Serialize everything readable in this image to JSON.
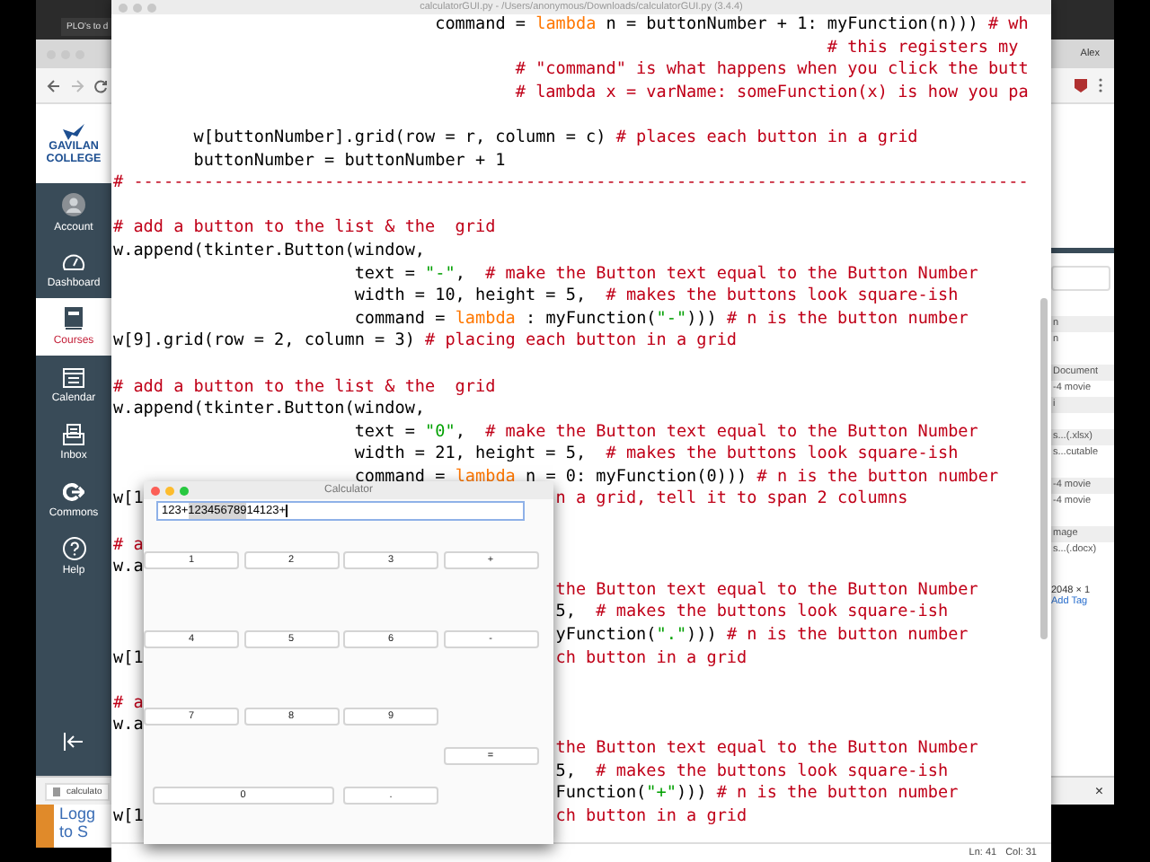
{
  "back_window": {
    "tab_title": "PLO's to d"
  },
  "browser": {
    "profile": "Alex",
    "sidebar": {
      "logo": [
        "GAVILAN",
        "COLLEGE"
      ],
      "items": [
        {
          "kind": "account",
          "label": "Account",
          "selected": false
        },
        {
          "kind": "dashboard",
          "label": "Dashboard",
          "selected": false
        },
        {
          "kind": "courses",
          "label": "Courses",
          "selected": true
        },
        {
          "kind": "calendar",
          "label": "Calendar",
          "selected": false
        },
        {
          "kind": "inbox",
          "label": "Inbox",
          "selected": false
        },
        {
          "kind": "commons",
          "label": "Commons",
          "selected": false
        },
        {
          "kind": "help",
          "label": "Help",
          "selected": false
        }
      ]
    },
    "right_panel": {
      "file_groups": [
        [
          "n",
          "n"
        ],
        [
          "Document",
          "-4 movie",
          "i"
        ],
        [
          "s...(.xlsx)",
          "s...cutable"
        ],
        [
          "-4 movie",
          "-4 movie"
        ],
        [
          "mage",
          "s...(.docx)"
        ]
      ],
      "dimensions": "2048 × 1",
      "add_tag": "Add Tag"
    },
    "download_bar": {
      "file": "calculato",
      "close": "×"
    }
  },
  "background_page": {
    "lines": [
      "Logg",
      "to S"
    ]
  },
  "editor": {
    "title": "calculatorGUI.py - /Users/anonymous/Downloads/calculatorGUI.py (3.4.4)",
    "lines": [
      {
        "kind": "full",
        "segments": [
          {
            "kind": "code",
            "text": "                                command = "
          },
          {
            "kind": "keyword",
            "text": "lambda"
          },
          {
            "kind": "code",
            "text": " n = buttonNumber + 1: myFunction(n))) "
          },
          {
            "kind": "comment",
            "text": "# wh"
          }
        ]
      },
      {
        "kind": "full",
        "segments": [
          {
            "kind": "comment",
            "text": "                                                                       # this registers my"
          }
        ]
      },
      {
        "kind": "full",
        "segments": [
          {
            "kind": "comment",
            "text": "                                        # \"command\" is what happens when you click the butt"
          }
        ]
      },
      {
        "kind": "full",
        "segments": [
          {
            "kind": "comment",
            "text": "                                        # lambda x = varName: someFunction(x) is how you pa"
          }
        ]
      },
      {
        "kind": "blank"
      },
      {
        "kind": "full",
        "segments": [
          {
            "kind": "code",
            "text": "        w[buttonNumber].grid(row = r, column = c) "
          },
          {
            "kind": "comment",
            "text": "# places each button in a grid"
          }
        ]
      },
      {
        "kind": "full",
        "segments": [
          {
            "kind": "code",
            "text": "        buttonNumber = buttonNumber + 1"
          }
        ]
      },
      {
        "kind": "full",
        "segments": [
          {
            "kind": "comment",
            "text": "# -----------------------------------------------------------------------------------------"
          }
        ]
      },
      {
        "kind": "blank"
      },
      {
        "kind": "full",
        "segments": [
          {
            "kind": "comment",
            "text": "# add a button to the list & the  grid"
          }
        ]
      },
      {
        "kind": "full",
        "segments": [
          {
            "kind": "code",
            "text": "w.append(tkinter.Button(window,"
          }
        ]
      },
      {
        "kind": "full",
        "segments": [
          {
            "kind": "code",
            "text": "                        text = "
          },
          {
            "kind": "string",
            "text": "\"-\""
          },
          {
            "kind": "code",
            "text": ",  "
          },
          {
            "kind": "comment",
            "text": "# make the Button text equal to the Button Number"
          }
        ]
      },
      {
        "kind": "full",
        "segments": [
          {
            "kind": "code",
            "text": "                        width = 10, height = 5,  "
          },
          {
            "kind": "comment",
            "text": "# makes the buttons look square-ish"
          }
        ]
      },
      {
        "kind": "full",
        "segments": [
          {
            "kind": "code",
            "text": "                        command = "
          },
          {
            "kind": "keyword",
            "text": "lambda"
          },
          {
            "kind": "code",
            "text": " : myFunction("
          },
          {
            "kind": "string",
            "text": "\"-\""
          },
          {
            "kind": "code",
            "text": "))) "
          },
          {
            "kind": "comment",
            "text": "# n is the button number"
          }
        ]
      },
      {
        "kind": "full",
        "segments": [
          {
            "kind": "code",
            "text": "w[9].grid(row = 2, column = 3) "
          },
          {
            "kind": "comment",
            "text": "# placing each button in a grid"
          }
        ]
      },
      {
        "kind": "blank"
      },
      {
        "kind": "full",
        "segments": [
          {
            "kind": "comment",
            "text": "# add a button to the list & the  grid"
          }
        ]
      },
      {
        "kind": "full",
        "segments": [
          {
            "kind": "code",
            "text": "w.append(tkinter.Button(window,"
          }
        ]
      },
      {
        "kind": "full",
        "segments": [
          {
            "kind": "code",
            "text": "                        text = "
          },
          {
            "kind": "string",
            "text": "\"0\""
          },
          {
            "kind": "code",
            "text": ",  "
          },
          {
            "kind": "comment",
            "text": "# make the Button text equal to the Button Number"
          }
        ]
      },
      {
        "kind": "full",
        "segments": [
          {
            "kind": "code",
            "text": "                        width = 21, height = 5,  "
          },
          {
            "kind": "comment",
            "text": "# makes the buttons look square-ish"
          }
        ]
      },
      {
        "kind": "full",
        "segments": [
          {
            "kind": "code",
            "text": "                        command = "
          },
          {
            "kind": "keyword",
            "text": "lambda"
          },
          {
            "kind": "code",
            "text": " n = 0: myFunction(0))) "
          },
          {
            "kind": "comment",
            "text": "# n is the button number"
          }
        ]
      },
      {
        "kind": "split",
        "left": [
          {
            "kind": "code",
            "text": "w[1"
          }
        ],
        "right": [
          {
            "kind": "comment",
            "text": "n a grid, tell it to span 2 columns"
          }
        ]
      },
      {
        "kind": "blank"
      },
      {
        "kind": "split",
        "left": [
          {
            "kind": "comment",
            "text": "# a"
          }
        ]
      },
      {
        "kind": "split",
        "left": [
          {
            "kind": "code",
            "text": "w.a"
          }
        ]
      },
      {
        "kind": "split",
        "right": [
          {
            "kind": "comment",
            "text": "the Button text equal to the Button Number"
          }
        ]
      },
      {
        "kind": "split",
        "right": [
          {
            "kind": "code",
            "text": "5,  "
          },
          {
            "kind": "comment",
            "text": "# makes the buttons look square-ish"
          }
        ]
      },
      {
        "kind": "split",
        "right": [
          {
            "kind": "code",
            "text": "yFunction("
          },
          {
            "kind": "string",
            "text": "\".\""
          },
          {
            "kind": "code",
            "text": "))) "
          },
          {
            "kind": "comment",
            "text": "# n is the button number"
          }
        ]
      },
      {
        "kind": "split",
        "left": [
          {
            "kind": "code",
            "text": "w[1"
          }
        ],
        "right": [
          {
            "kind": "comment",
            "text": "ch button in a grid"
          }
        ]
      },
      {
        "kind": "blank"
      },
      {
        "kind": "split",
        "left": [
          {
            "kind": "comment",
            "text": "# a"
          }
        ]
      },
      {
        "kind": "split",
        "left": [
          {
            "kind": "code",
            "text": "w.a"
          }
        ]
      },
      {
        "kind": "split",
        "right": [
          {
            "kind": "comment",
            "text": "the Button text equal to the Button Number"
          }
        ]
      },
      {
        "kind": "split",
        "right": [
          {
            "kind": "code",
            "text": "5,  "
          },
          {
            "kind": "comment",
            "text": "# makes the buttons look square-ish"
          }
        ]
      },
      {
        "kind": "split",
        "right": [
          {
            "kind": "code",
            "text": "Function("
          },
          {
            "kind": "string",
            "text": "\"+\""
          },
          {
            "kind": "code",
            "text": "))) "
          },
          {
            "kind": "comment",
            "text": "# n is the button number"
          }
        ]
      },
      {
        "kind": "split",
        "left": [
          {
            "kind": "code",
            "text": "w[1"
          }
        ],
        "right": [
          {
            "kind": "comment",
            "text": "ch button in a grid"
          }
        ]
      }
    ],
    "status": {
      "line": "Ln: 41",
      "column": "Col: 31"
    }
  },
  "calculator": {
    "title": "Calculator",
    "entry": {
      "before": "123+",
      "selected_text": "123456789",
      "after": "14123+"
    },
    "rows": [
      [
        {
          "kind": "key",
          "label": "1"
        },
        {
          "kind": "key",
          "label": "2"
        },
        {
          "kind": "key",
          "label": "3"
        },
        {
          "kind": "key",
          "label": "+"
        }
      ],
      [
        {
          "kind": "key",
          "label": "4"
        },
        {
          "kind": "key",
          "label": "5"
        },
        {
          "kind": "key",
          "label": "6"
        },
        {
          "kind": "key",
          "label": "-"
        }
      ],
      [
        {
          "kind": "key",
          "label": "7"
        },
        {
          "kind": "key",
          "label": "8"
        },
        {
          "kind": "key",
          "label": "9"
        }
      ],
      [
        {
          "kind": "gap"
        },
        {
          "kind": "gap"
        },
        {
          "kind": "gap"
        },
        {
          "kind": "key",
          "label": "="
        }
      ],
      [
        {
          "kind": "wide",
          "label": "0"
        },
        {
          "kind": "gap"
        },
        {
          "kind": "key",
          "label": "."
        }
      ]
    ]
  }
}
